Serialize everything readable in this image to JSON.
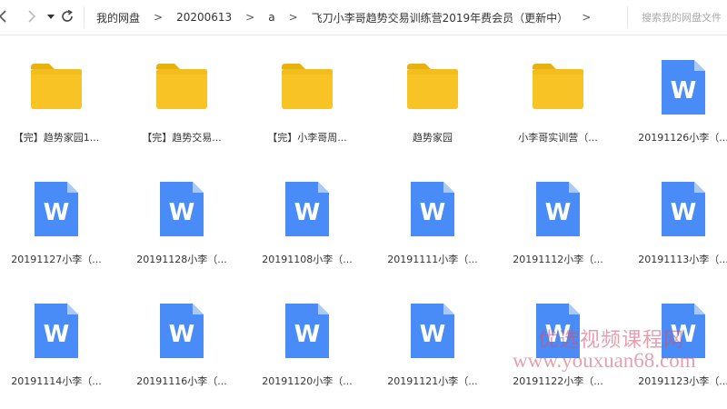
{
  "nav": {
    "back_icon": "chevron-left-icon",
    "forward_icon": "chevron-right-icon",
    "history_icon": "caret-down-icon",
    "refresh_icon": "refresh-icon"
  },
  "breadcrumbs": [
    "我的网盘",
    "20200613",
    "a",
    "飞刀小李哥趋势交易训练营2019年费会员（更新中）"
  ],
  "search": {
    "placeholder": "搜索我的网盘文件"
  },
  "colors": {
    "folder": "#f7c325",
    "folder_tab": "#e8b20e",
    "word": "#4a8cf7",
    "word_fold": "#a9c9fb"
  },
  "rows": [
    [
      {
        "type": "folder",
        "label": "【完】趋势家园1..."
      },
      {
        "type": "folder",
        "label": "【完】趋势交易..."
      },
      {
        "type": "folder",
        "label": "【完】小李哥周..."
      },
      {
        "type": "folder",
        "label": "趋势家园"
      },
      {
        "type": "folder",
        "label": "小李哥实训营（..."
      },
      {
        "type": "word",
        "label": "20191126小李（..."
      }
    ],
    [
      {
        "type": "word",
        "label": "20191127小李（..."
      },
      {
        "type": "word",
        "label": "20191128小李（..."
      },
      {
        "type": "word",
        "label": "20191108小李（..."
      },
      {
        "type": "word",
        "label": "20191111小李（..."
      },
      {
        "type": "word",
        "label": "20191112小李（..."
      },
      {
        "type": "word",
        "label": "20191113小李（..."
      }
    ],
    [
      {
        "type": "word",
        "label": "20191114小李（..."
      },
      {
        "type": "word",
        "label": "20191116小李（..."
      },
      {
        "type": "word",
        "label": "20191120小李（..."
      },
      {
        "type": "word",
        "label": "20191121小李（..."
      },
      {
        "type": "word",
        "label": "20191122小李（..."
      },
      {
        "type": "word",
        "label": "20191123小李（..."
      }
    ]
  ],
  "word_letter": "W",
  "watermark": {
    "line1": "优选视频课程网",
    "line2": "www.youxuan68.com"
  }
}
